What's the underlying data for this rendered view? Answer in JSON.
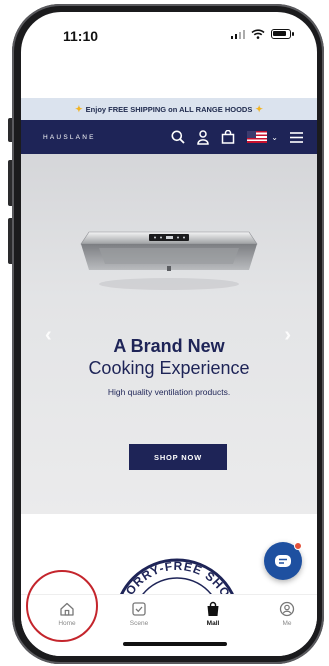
{
  "status_bar": {
    "time": "11:10"
  },
  "promo": {
    "text": "Enjoy FREE SHIPPING on ALL RANGE HOODS"
  },
  "navbar": {
    "logo": "HAUSLANE"
  },
  "hero": {
    "title_line1": "A Brand New",
    "title_line2": "Cooking Experience",
    "subtitle": "High quality ventilation products.",
    "cta": "SHOP NOW"
  },
  "badge": {
    "text": "WORRY-FREE SHOP"
  },
  "tabbar": {
    "tabs": [
      {
        "label": "Home",
        "icon": "house-icon"
      },
      {
        "label": "Scene",
        "icon": "checkbox-icon"
      },
      {
        "label": "Mall",
        "icon": "shopping-bag-icon"
      },
      {
        "label": "Me",
        "icon": "user-icon"
      }
    ],
    "active": "Mall"
  },
  "colors": {
    "navy": "#1e2457",
    "promo_bg": "#dbe3ee",
    "chat_blue": "#1e50a0",
    "annotation_red": "#c4252c"
  }
}
